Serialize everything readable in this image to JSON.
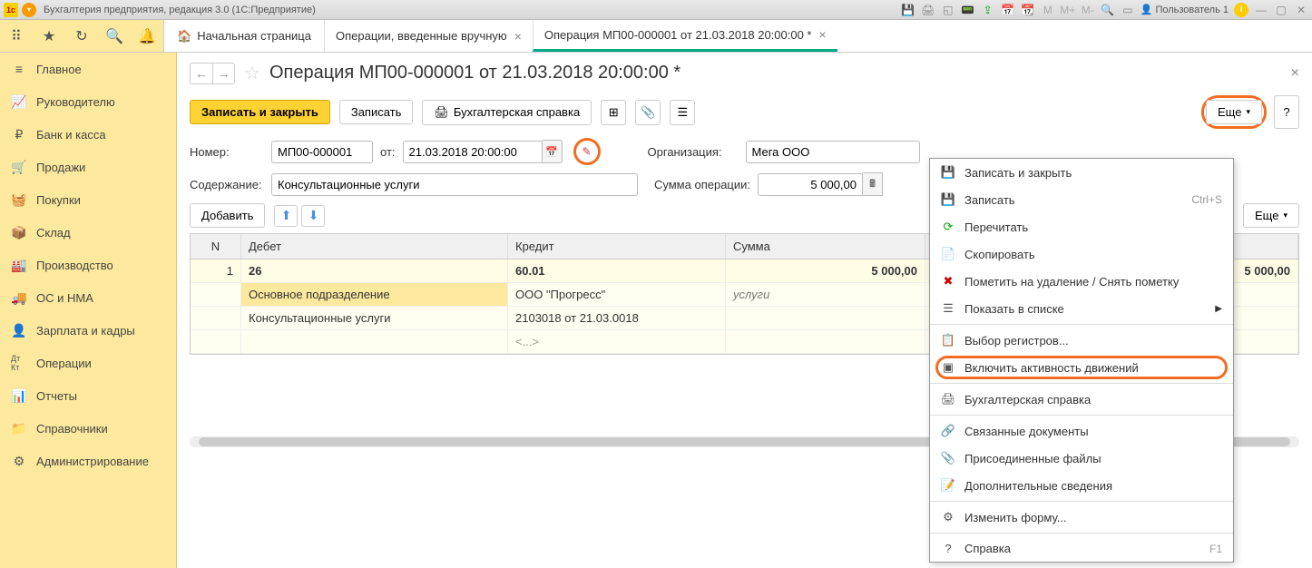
{
  "titlebar": {
    "text": "Бухгалтерия предприятия, редакция 3.0  (1С:Предприятие)",
    "user": "Пользователь 1"
  },
  "nav": {
    "home": "Начальная страница",
    "tab1": "Операции, введенные вручную",
    "tab2": "Операция МП00-000001 от 21.03.2018 20:00:00 *"
  },
  "sidebar": {
    "items": [
      {
        "label": "Главное"
      },
      {
        "label": "Руководителю"
      },
      {
        "label": "Банк и касса"
      },
      {
        "label": "Продажи"
      },
      {
        "label": "Покупки"
      },
      {
        "label": "Склад"
      },
      {
        "label": "Производство"
      },
      {
        "label": "ОС и НМА"
      },
      {
        "label": "Зарплата и кадры"
      },
      {
        "label": "Операции"
      },
      {
        "label": "Отчеты"
      },
      {
        "label": "Справочники"
      },
      {
        "label": "Администрирование"
      }
    ]
  },
  "page": {
    "title": "Операция МП00-000001 от 21.03.2018 20:00:00 *"
  },
  "toolbar": {
    "save_close": "Записать и закрыть",
    "save": "Записать",
    "acc_report": "Бухгалтерская справка",
    "more": "Еще",
    "help": "?"
  },
  "form": {
    "number_label": "Номер:",
    "number_value": "МП00-000001",
    "date_label": "от:",
    "date_value": "21.03.2018 20:00:00",
    "org_label": "Организация:",
    "org_value": "Мега ООО",
    "desc_label": "Содержание:",
    "desc_value": "Консультационные услуги",
    "sum_label": "Сумма операции:",
    "sum_value": "5 000,00"
  },
  "table_toolbar": {
    "add": "Добавить",
    "more": "Еще"
  },
  "table": {
    "headers": {
      "n": "N",
      "debit": "Дебет",
      "credit": "Кредит",
      "sum": "Сумма"
    },
    "rows": [
      {
        "n": "1",
        "debit": "26",
        "credit": "60.01",
        "sum": "5 000,00",
        "sum2": "5 000,00"
      },
      {
        "debit": "Основное подразделение",
        "credit": "ООО \"Прогресс\"",
        "sum_text": "услуги"
      },
      {
        "debit": "Консультационные услуги",
        "credit": "2103018 от 21.03.0018"
      },
      {
        "credit": "<...>"
      }
    ]
  },
  "menu": {
    "items": [
      {
        "icon": "save-icon",
        "label": "Записать и закрыть"
      },
      {
        "icon": "disk-icon",
        "label": "Записать",
        "shortcut": "Ctrl+S"
      },
      {
        "icon": "refresh-icon",
        "label": "Перечитать"
      },
      {
        "icon": "copy-icon",
        "label": "Скопировать"
      },
      {
        "icon": "delete-icon",
        "label": "Пометить на удаление / Снять пометку"
      },
      {
        "icon": "list-icon",
        "label": "Показать в списке",
        "arrow": true
      },
      {
        "icon": "registers-icon",
        "label": "Выбор регистров..."
      },
      {
        "icon": "activity-icon",
        "label": "Включить активность движений",
        "circled": true
      },
      {
        "icon": "print-icon",
        "label": "Бухгалтерская справка"
      },
      {
        "icon": "links-icon",
        "label": "Связанные документы"
      },
      {
        "icon": "attach-icon",
        "label": "Присоединенные файлы"
      },
      {
        "icon": "info-icon",
        "label": "Дополнительные сведения"
      },
      {
        "icon": "form-icon",
        "label": "Изменить форму..."
      },
      {
        "icon": "help-icon",
        "label": "Справка",
        "shortcut": "F1"
      }
    ]
  }
}
